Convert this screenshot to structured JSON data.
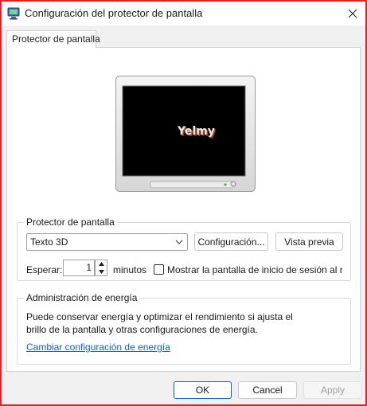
{
  "window": {
    "title": "Configuración del protector de pantalla",
    "accent_border_color": "#e0202a"
  },
  "tabs": [
    {
      "label": "Protector de pantalla",
      "selected": true
    }
  ],
  "preview": {
    "preview_text": "Yelmy"
  },
  "screensaver_group": {
    "legend": "Protector de pantalla",
    "selected_screensaver": "Texto 3D",
    "settings_button": "Configuración...",
    "preview_button": "Vista previa",
    "wait_label": "Esperar:",
    "wait_value": "1",
    "minutes_label": "minutos",
    "logon_checkbox_label": "Mostrar la pantalla de inicio de sesión al re",
    "logon_checked": false
  },
  "power_group": {
    "legend": "Administración de energía",
    "description_line1": "Puede conservar energía y optimizar el rendimiento si ajusta el",
    "description_line2": "brillo de la pantalla y otras configuraciones de energía.",
    "link": "Cambiar configuración de energía"
  },
  "footer": {
    "ok": "OK",
    "cancel": "Cancel",
    "apply": "Apply"
  }
}
